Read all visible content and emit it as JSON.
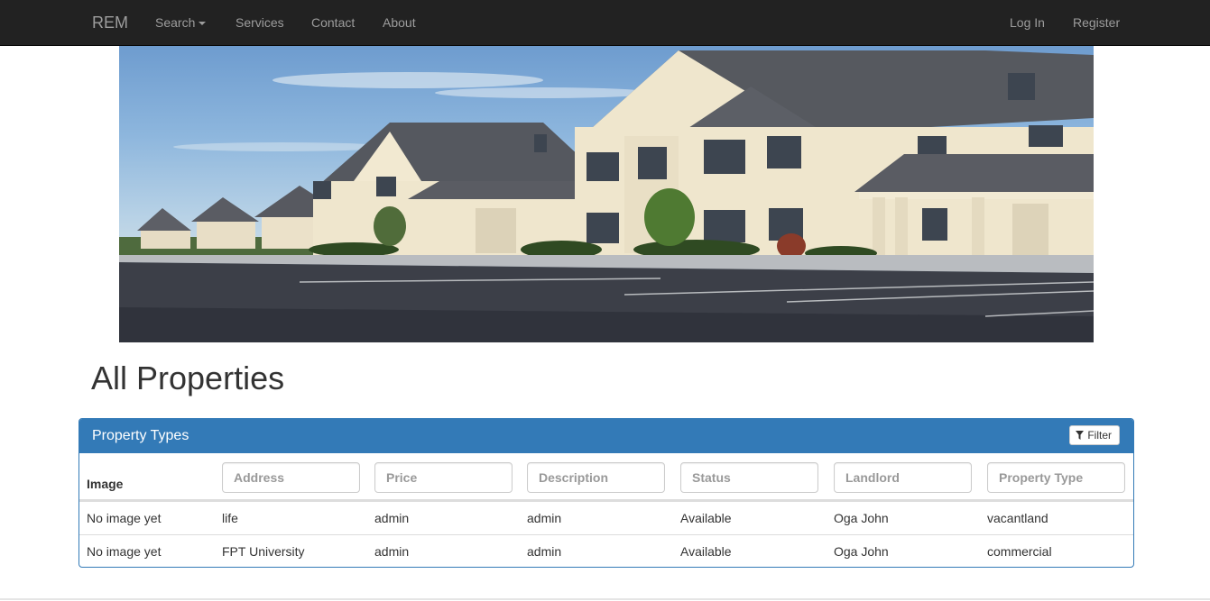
{
  "navbar": {
    "brand": "REM",
    "search_label": "Search",
    "services_label": "Services",
    "contact_label": "Contact",
    "about_label": "About",
    "login_label": "Log In",
    "register_label": "Register"
  },
  "page": {
    "title": "All Properties"
  },
  "panel": {
    "title": "Property Types",
    "filter_label": "Filter",
    "image_header": "Image",
    "filters": [
      {
        "placeholder": "Address"
      },
      {
        "placeholder": "Price"
      },
      {
        "placeholder": "Description"
      },
      {
        "placeholder": "Status"
      },
      {
        "placeholder": "Landlord"
      },
      {
        "placeholder": "Property Type"
      }
    ],
    "rows": [
      {
        "image": "No image yet",
        "address": "life",
        "price": "admin",
        "description": "admin",
        "status": "Available",
        "landlord": "Oga John",
        "type": "vacantland"
      },
      {
        "image": "No image yet",
        "address": "FPT University",
        "price": "admin",
        "description": "admin",
        "status": "Available",
        "landlord": "Oga John",
        "type": "commercial"
      }
    ]
  },
  "colors": {
    "navbar_bg": "#222222",
    "nav_text": "#9d9d9d",
    "panel_primary": "#337ab7"
  },
  "icons": {
    "filter": "funnel-icon",
    "search_dropdown": "caret-down-icon"
  }
}
